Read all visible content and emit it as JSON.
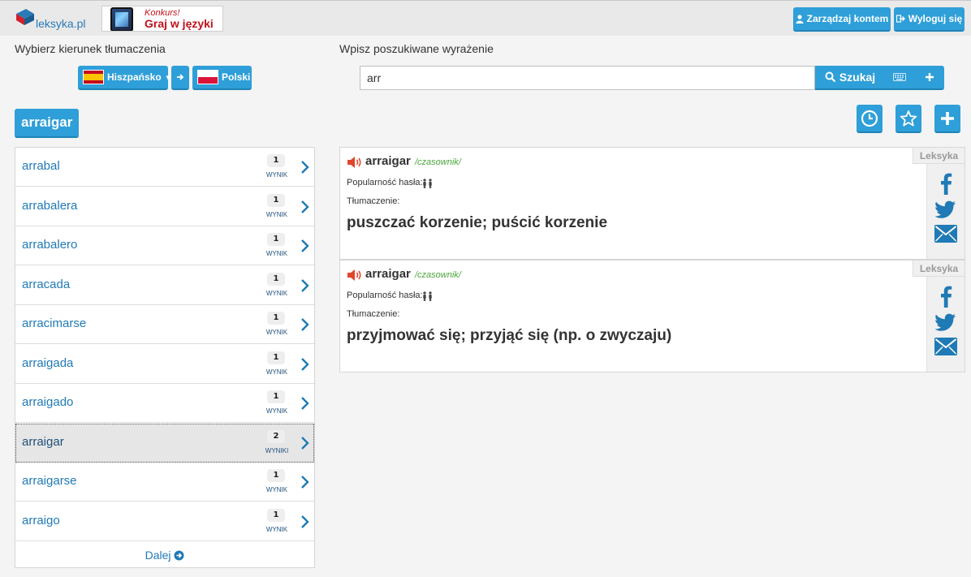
{
  "header": {
    "logo_text": "leksyka.pl",
    "banner_line1": "Konkurs!",
    "banner_line2": "Graj w językі",
    "manage_label": "Zarządzaj kontem",
    "logout_label": "Wyloguj się"
  },
  "direction": {
    "label": "Wybierz kierunek tłumaczenia",
    "source_lang": "Hiszpańsko",
    "target_lang": "Polski"
  },
  "search": {
    "label": "Wpisz poszukiwane wyrażenie",
    "value": "arr",
    "button_label": "Szukaj"
  },
  "current_word": "arraigar",
  "list": {
    "items": [
      {
        "word": "arrabal",
        "count": "1",
        "unit": "WYNIK"
      },
      {
        "word": "arrabalera",
        "count": "1",
        "unit": "WYNIK"
      },
      {
        "word": "arrabalero",
        "count": "1",
        "unit": "WYNIK"
      },
      {
        "word": "arracada",
        "count": "1",
        "unit": "WYNIK"
      },
      {
        "word": "arracimarse",
        "count": "1",
        "unit": "WYNIK"
      },
      {
        "word": "arraigada",
        "count": "1",
        "unit": "WYNIK"
      },
      {
        "word": "arraigado",
        "count": "1",
        "unit": "WYNIK"
      },
      {
        "word": "arraigar",
        "count": "2",
        "unit": "WYNIKI"
      },
      {
        "word": "arraigarse",
        "count": "1",
        "unit": "WYNIK"
      },
      {
        "word": "arraigo",
        "count": "1",
        "unit": "WYNIK"
      }
    ],
    "selected_index": 7,
    "more_label": "Dalej"
  },
  "entries": [
    {
      "headword": "arraigar",
      "pos": "/czasownik/",
      "popularity_label": "Popularność hasła:",
      "translation_label": "Tłumaczenie:",
      "translation": "puszczać korzenie; puścić korzenie",
      "source": "Leksyka"
    },
    {
      "headword": "arraigar",
      "pos": "/czasownik/",
      "popularity_label": "Popularność hasła:",
      "translation_label": "Tłumaczenie:",
      "translation": "przyjmować się; przyjąć się (np. o zwyczaju)",
      "source": "Leksyka"
    }
  ],
  "colors": {
    "accent": "#2e9fd8",
    "link": "#1f7ab5",
    "pos": "#4aa53a",
    "speaker": "#e0462c"
  }
}
